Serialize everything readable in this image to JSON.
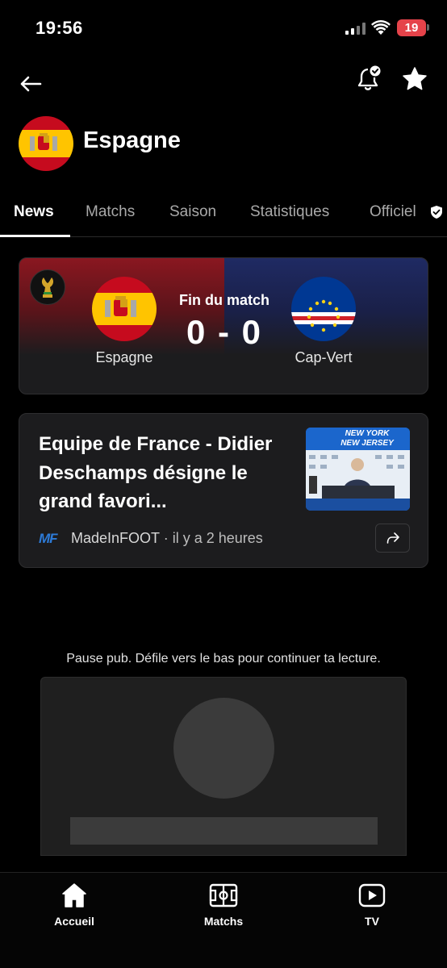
{
  "status_bar": {
    "time": "19:56",
    "battery": "19"
  },
  "header": {
    "team_name": "Espagne",
    "icons": [
      "back-arrow-icon",
      "bell-check-icon",
      "star-icon"
    ]
  },
  "tabs": [
    {
      "label": "News",
      "active": true
    },
    {
      "label": "Matchs",
      "active": false
    },
    {
      "label": "Saison",
      "active": false
    },
    {
      "label": "Statistiques",
      "active": false
    },
    {
      "label": "Officiel",
      "active": false
    }
  ],
  "match": {
    "status": "Fin du match",
    "score": "0 - 0",
    "home_team": "Espagne",
    "away_team": "Cap-Vert",
    "competition_logo_text": "FIFA"
  },
  "news": {
    "title": "Equipe de France - Didier Deschamps désigne le grand favori...",
    "source_logo": "MF",
    "source": "MadeInFOOT",
    "time": "· il y a 2 heures",
    "thumb_caption": "NEW YORK NEW JERSEY"
  },
  "ad": {
    "notice": "Pause pub. Défile vers le bas pour continuer ta lecture."
  },
  "bottom_nav": [
    {
      "label": "Accueil",
      "icon": "home-icon"
    },
    {
      "label": "Matchs",
      "icon": "pitch-icon"
    },
    {
      "label": "TV",
      "icon": "play-icon"
    }
  ],
  "colors": {
    "background": "#000000",
    "card": "#1c1c1e",
    "home_accent": "#8a1720",
    "away_accent": "#1f2a63",
    "battery": "#e5434a",
    "source_logo": "#2d7bd8"
  }
}
